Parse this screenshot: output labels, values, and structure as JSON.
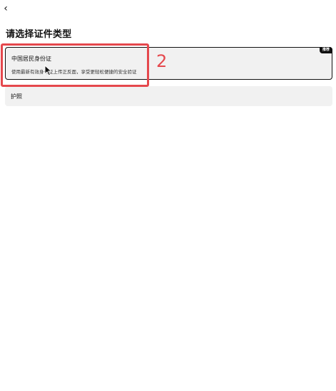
{
  "header": {
    "back_icon": "chevron-left-icon",
    "back_glyph": "‹"
  },
  "page": {
    "title": "请选择证件类型"
  },
  "options": [
    {
      "title": "中国居民身份证",
      "description": "使用最新有效身份证上传正反面，享受更轻松便捷的安全验证",
      "badge": "推荐",
      "selected": true
    },
    {
      "title": "护照",
      "selected": false
    }
  ],
  "overlay": {
    "step_number": "2",
    "highlight_color": "#e5484d"
  }
}
